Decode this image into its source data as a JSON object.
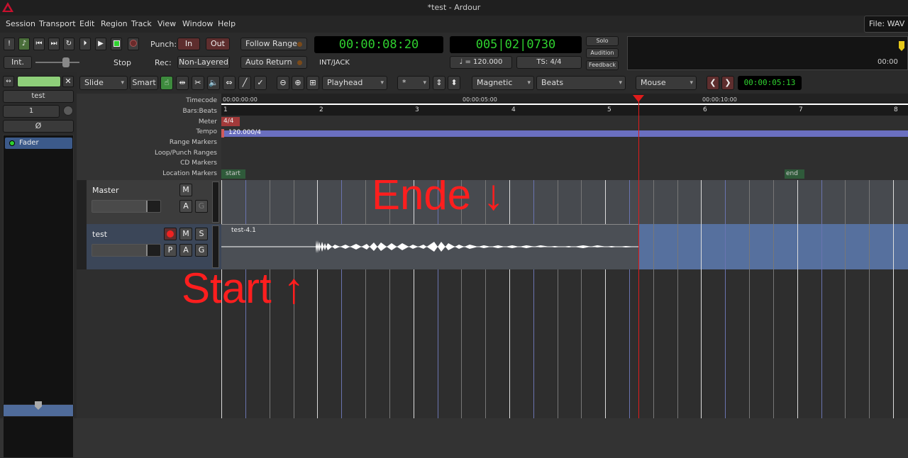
{
  "window": {
    "title": "*test - Ardour"
  },
  "menu": [
    "Session",
    "Transport",
    "Edit",
    "Region",
    "Track",
    "View",
    "Window",
    "Help"
  ],
  "file_info": "File: WAV",
  "transport": {
    "punch_label": "Punch:",
    "punch_in": "In",
    "punch_out": "Out",
    "rec_label": "Rec:",
    "rec_mode": "Non-Layered",
    "follow_range": "Follow Range",
    "auto_return": "Auto Return",
    "int": "Int.",
    "stop": "Stop",
    "primary_clock": "00:00:08:20",
    "primary_clock_sub": "INT/JACK",
    "secondary_clock": "005|02|0730",
    "tempo": "♩ = 120.000",
    "ts": "TS: 4/4",
    "solo": "Solo",
    "audition": "Audition",
    "feedback": "Feedback",
    "mini_time": "00:00"
  },
  "edit_toolbar": {
    "edit_mode": "Slide",
    "smart": "Smart",
    "edit_point": "Playhead",
    "grid": "*",
    "snap_mode": "Magnetic",
    "snap_unit": "Beats",
    "mouse_mode": "Mouse",
    "nudge_clock": "00:00:05:13"
  },
  "editor_mixer": {
    "name": "test",
    "input": "1",
    "phase": "Ø",
    "fader": "Fader"
  },
  "ruler_labels": [
    "Timecode",
    "Bars:Beats",
    "Meter",
    "Tempo",
    "Range Markers",
    "Loop/Punch Ranges",
    "CD Markers",
    "Location Markers"
  ],
  "timecode_ticks": [
    "00:00:00:00",
    "00:00:05:00",
    "00:00:10:00"
  ],
  "bars": [
    "1",
    "2",
    "3",
    "4",
    "5",
    "6",
    "7",
    "8"
  ],
  "meter": "4/4",
  "tempo_marker": "120.000/4",
  "markers": {
    "start": "start",
    "end": "end"
  },
  "tracks": [
    {
      "name": "Master",
      "buttons": [
        "M",
        "A",
        "G"
      ]
    },
    {
      "name": "test",
      "buttons": [
        "M",
        "S",
        "P",
        "A",
        "G"
      ],
      "region": "test-4.1"
    }
  ],
  "annotations": {
    "end": "Ende ↓",
    "start": "Start ↑"
  },
  "colors": {
    "clock_green": "#2fd12f",
    "playhead": "#e01b1b",
    "annotation": "#ff1e1e",
    "region_bg": "#4b4f55",
    "selected_track": "#495f93"
  }
}
